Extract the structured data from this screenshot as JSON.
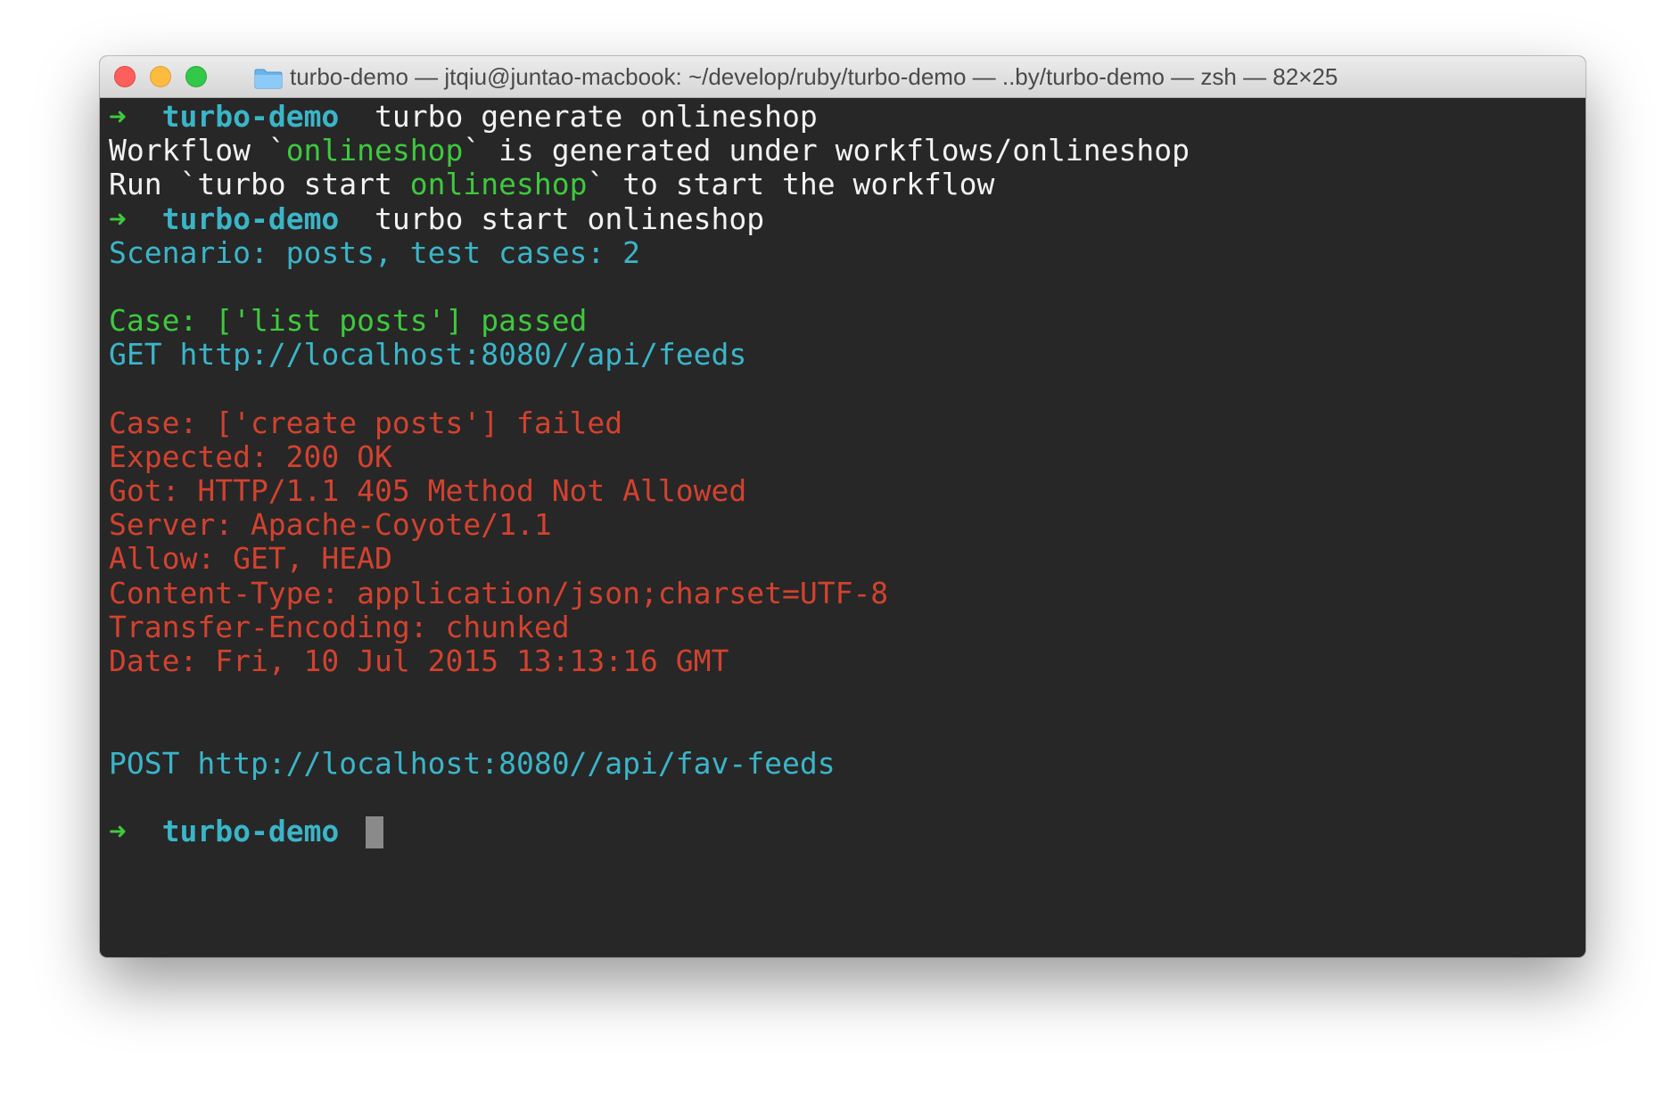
{
  "window": {
    "title": "turbo-demo — jtqiu@juntao-macbook: ~/develop/ruby/turbo-demo — ..by/turbo-demo — zsh — 82×25",
    "folder_icon": "folder-icon",
    "colors": {
      "terminal_bg": "#272727",
      "prompt_arrow": "#3ec93e",
      "prompt_dir": "#3bb5c8",
      "success": "#3ec93e",
      "info": "#3bb5c8",
      "error": "#d2422f"
    }
  },
  "prompt": {
    "arrow": "➜",
    "dir": "turbo-demo"
  },
  "terminal": {
    "cmd1": "turbo generate onlineshop",
    "gen_prefix": "Workflow `",
    "gen_name": "onlineshop",
    "gen_suffix": "` is generated under workflows/onlineshop",
    "run_prefix": "Run `turbo start ",
    "run_name": "onlineshop",
    "run_suffix": "` to start the workflow",
    "cmd2": "turbo start onlineshop",
    "scenario": "Scenario: posts, test cases: 2",
    "case1": "Case: ['list posts'] passed",
    "case1_request": "GET http://localhost:8080//api/feeds",
    "case2": "Case: ['create posts'] failed",
    "case2_details": [
      "Expected: 200 OK",
      "Got: HTTP/1.1 405 Method Not Allowed",
      "Server: Apache-Coyote/1.1",
      "Allow: GET, HEAD",
      "Content-Type: application/json;charset=UTF-8",
      "Transfer-Encoding: chunked",
      "Date: Fri, 10 Jul 2015 13:13:16 GMT"
    ],
    "case2_request": "POST http://localhost:8080//api/fav-feeds"
  }
}
